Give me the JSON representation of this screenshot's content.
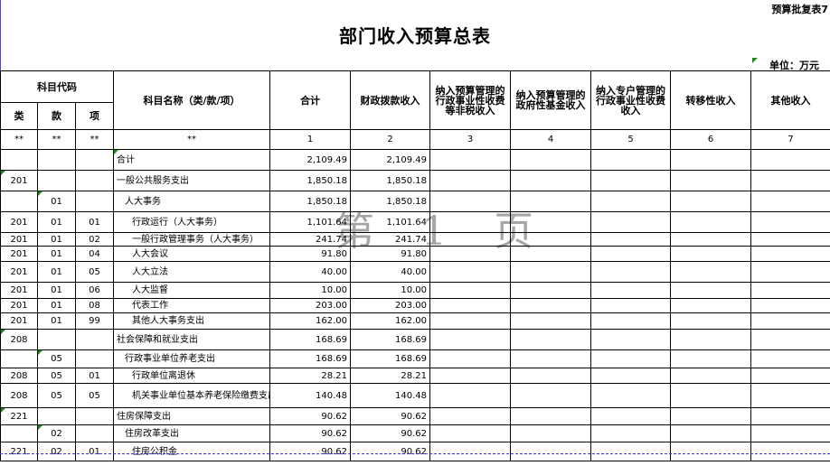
{
  "top_code": "预算批复表7",
  "title": "部门收入预算总表",
  "unit": "单位：万元",
  "watermark": {
    "a": "第",
    "b": "1",
    "c": "页"
  },
  "headers": {
    "code_group": "科目代码",
    "lei": "类",
    "kuan": "款",
    "xiang": "项",
    "name": "科目名称（类/款/项）",
    "total": "合计",
    "fiscal": "财政拨款收入",
    "col3": "纳入预算管理的行政事业性收费等非税收入",
    "col4": "纳入预算管理的政府性基金收入",
    "col5": "纳入专户管理的行政事业性收费收入",
    "col6": "转移性收入",
    "col7": "其他收入"
  },
  "index_row": [
    "**",
    "**",
    "**",
    "**",
    "1",
    "2",
    "3",
    "4",
    "5",
    "6",
    "7"
  ],
  "rows": [
    {
      "lei": "",
      "kuan": "",
      "xiang": "",
      "name": "合计",
      "total": "2,109.49",
      "fiscal": "2,109.49"
    },
    {
      "lei": "201",
      "kuan": "",
      "xiang": "",
      "name": "一般公共服务支出",
      "total": "1,850.18",
      "fiscal": "1,850.18"
    },
    {
      "lei": "",
      "kuan": "01",
      "xiang": "",
      "name": "人大事务",
      "total": "1,850.18",
      "fiscal": "1,850.18"
    },
    {
      "lei": "201",
      "kuan": "01",
      "xiang": "01",
      "name": "行政运行（人大事务）",
      "total": "1,101.64",
      "fiscal": "1,101.64"
    },
    {
      "lei": "201",
      "kuan": "01",
      "xiang": "02",
      "name": "一般行政管理事务（人大事务）",
      "total": "241.74",
      "fiscal": "241.74"
    },
    {
      "lei": "201",
      "kuan": "01",
      "xiang": "04",
      "name": "人大会议",
      "total": "91.80",
      "fiscal": "91.80"
    },
    {
      "lei": "201",
      "kuan": "01",
      "xiang": "05",
      "name": "人大立法",
      "total": "40.00",
      "fiscal": "40.00"
    },
    {
      "lei": "201",
      "kuan": "01",
      "xiang": "06",
      "name": "人大监督",
      "total": "10.00",
      "fiscal": "10.00"
    },
    {
      "lei": "201",
      "kuan": "01",
      "xiang": "08",
      "name": "代表工作",
      "total": "203.00",
      "fiscal": "203.00"
    },
    {
      "lei": "201",
      "kuan": "01",
      "xiang": "99",
      "name": "其他人大事务支出",
      "total": "162.00",
      "fiscal": "162.00"
    },
    {
      "lei": "208",
      "kuan": "",
      "xiang": "",
      "name": "社会保障和就业支出",
      "total": "168.69",
      "fiscal": "168.69"
    },
    {
      "lei": "",
      "kuan": "05",
      "xiang": "",
      "name": "行政事业单位养老支出",
      "total": "168.69",
      "fiscal": "168.69"
    },
    {
      "lei": "208",
      "kuan": "05",
      "xiang": "01",
      "name": "行政单位离退休",
      "total": "28.21",
      "fiscal": "28.21"
    },
    {
      "lei": "208",
      "kuan": "05",
      "xiang": "05",
      "name": "机关事业单位基本养老保险缴费支出",
      "total": "140.48",
      "fiscal": "140.48"
    },
    {
      "lei": "221",
      "kuan": "",
      "xiang": "",
      "name": "住房保障支出",
      "total": "90.62",
      "fiscal": "90.62"
    },
    {
      "lei": "",
      "kuan": "02",
      "xiang": "",
      "name": "住房改革支出",
      "total": "90.62",
      "fiscal": "90.62"
    },
    {
      "lei": "221",
      "kuan": "02",
      "xiang": "01",
      "name": "住房公积金",
      "total": "90.62",
      "fiscal": "90.62"
    }
  ]
}
